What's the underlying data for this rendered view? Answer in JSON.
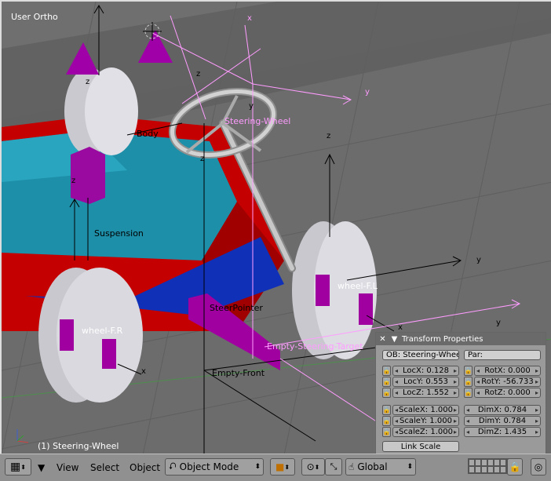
{
  "viewport": {
    "view_name": "User Ortho",
    "status": "(1) Steering-Wheel",
    "labels": {
      "steering_wheel": "Steering-Wheel",
      "suspension": "Suspension",
      "wheel_fl": "wheel-F.L",
      "wheel_fr": "wheel-F.R",
      "steer_pointer": "SteerPointer",
      "empty_steering_target": "Empty-Steering-Target",
      "empty_front": "Empty-Front",
      "body_partial": "Body",
      "axis_z": "z",
      "axis_y": "y",
      "axis_x": "x"
    }
  },
  "transform_panel": {
    "title": "Transform Properties",
    "ob": "OB: Steering-Wheel",
    "par": "Par:",
    "loc": [
      {
        "label": "LocX:",
        "value": "0.128"
      },
      {
        "label": "LocY:",
        "value": "0.553"
      },
      {
        "label": "LocZ:",
        "value": "1.552"
      }
    ],
    "rot": [
      {
        "label": "RotX:",
        "value": "0.000"
      },
      {
        "label": "RotY:",
        "value": "-56.733"
      },
      {
        "label": "RotZ:",
        "value": "0.000"
      }
    ],
    "scale": [
      {
        "label": "ScaleX:",
        "value": "1.000"
      },
      {
        "label": "ScaleY:",
        "value": "1.000"
      },
      {
        "label": "ScaleZ:",
        "value": "1.000"
      }
    ],
    "dim": [
      {
        "label": "DimX:",
        "value": "0.784"
      },
      {
        "label": "DimY:",
        "value": "0.784"
      },
      {
        "label": "DimZ:",
        "value": "1.435"
      }
    ],
    "link_scale": "Link Scale"
  },
  "header": {
    "view_menu": "View",
    "select_menu": "Select",
    "object_menu": "Object",
    "mode": "Object Mode",
    "orientation": "Global"
  }
}
